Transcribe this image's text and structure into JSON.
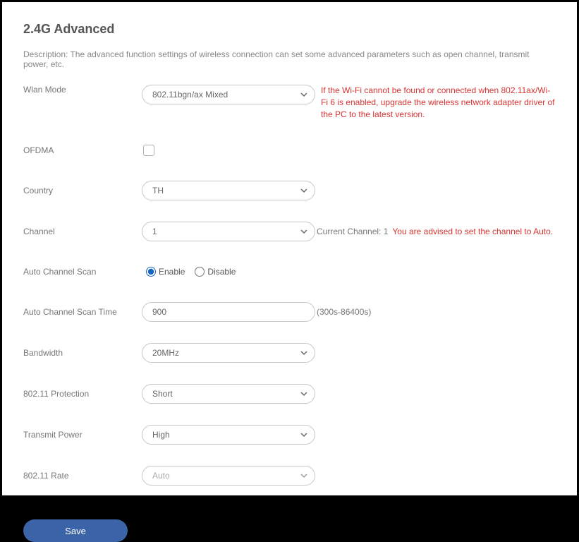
{
  "title": "2.4G Advanced",
  "description": "Description: The advanced function settings of wireless connection can set some advanced parameters such as open channel, transmit power, etc.",
  "labels": {
    "wlan_mode": "Wlan Mode",
    "ofdma": "OFDMA",
    "country": "Country",
    "channel": "Channel",
    "auto_scan": "Auto Channel Scan",
    "scan_time": "Auto Channel Scan Time",
    "bandwidth": "Bandwidth",
    "protection": "802.11 Protection",
    "tx_power": "Transmit Power",
    "rate": "802.11 Rate"
  },
  "values": {
    "wlan_mode": "802.11bgn/ax Mixed",
    "country": "TH",
    "channel": "1",
    "scan_time": "900",
    "bandwidth": "20MHz",
    "protection": "Short",
    "tx_power": "High",
    "rate": "Auto"
  },
  "hints": {
    "wlan_warn": "If the Wi-Fi cannot be found or connected when 802.11ax/Wi-Fi 6 is enabled, upgrade the wireless network adapter driver of the PC to the latest version.",
    "current_channel": "Current Channel: 1",
    "channel_advice": "You are advised to set the channel to Auto.",
    "scan_time_range": "(300s-86400s)"
  },
  "radio": {
    "enable": "Enable",
    "disable": "Disable"
  },
  "save": "Save"
}
